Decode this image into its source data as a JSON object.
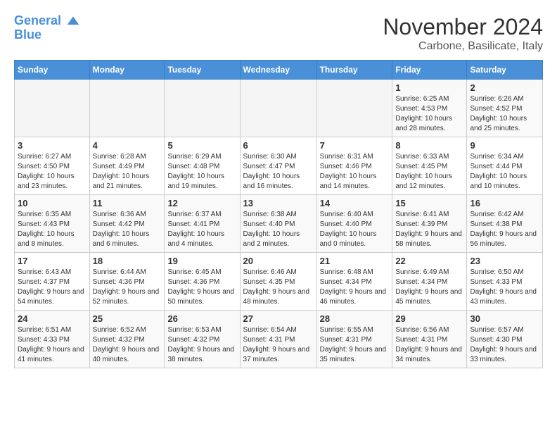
{
  "header": {
    "logo_line1": "General",
    "logo_line2": "Blue",
    "month_title": "November 2024",
    "location": "Carbone, Basilicate, Italy"
  },
  "columns": [
    "Sunday",
    "Monday",
    "Tuesday",
    "Wednesday",
    "Thursday",
    "Friday",
    "Saturday"
  ],
  "weeks": [
    [
      {
        "day": "",
        "info": ""
      },
      {
        "day": "",
        "info": ""
      },
      {
        "day": "",
        "info": ""
      },
      {
        "day": "",
        "info": ""
      },
      {
        "day": "",
        "info": ""
      },
      {
        "day": "1",
        "info": "Sunrise: 6:25 AM\nSunset: 4:53 PM\nDaylight: 10 hours and 28 minutes."
      },
      {
        "day": "2",
        "info": "Sunrise: 6:26 AM\nSunset: 4:52 PM\nDaylight: 10 hours and 25 minutes."
      }
    ],
    [
      {
        "day": "3",
        "info": "Sunrise: 6:27 AM\nSunset: 4:50 PM\nDaylight: 10 hours and 23 minutes."
      },
      {
        "day": "4",
        "info": "Sunrise: 6:28 AM\nSunset: 4:49 PM\nDaylight: 10 hours and 21 minutes."
      },
      {
        "day": "5",
        "info": "Sunrise: 6:29 AM\nSunset: 4:48 PM\nDaylight: 10 hours and 19 minutes."
      },
      {
        "day": "6",
        "info": "Sunrise: 6:30 AM\nSunset: 4:47 PM\nDaylight: 10 hours and 16 minutes."
      },
      {
        "day": "7",
        "info": "Sunrise: 6:31 AM\nSunset: 4:46 PM\nDaylight: 10 hours and 14 minutes."
      },
      {
        "day": "8",
        "info": "Sunrise: 6:33 AM\nSunset: 4:45 PM\nDaylight: 10 hours and 12 minutes."
      },
      {
        "day": "9",
        "info": "Sunrise: 6:34 AM\nSunset: 4:44 PM\nDaylight: 10 hours and 10 minutes."
      }
    ],
    [
      {
        "day": "10",
        "info": "Sunrise: 6:35 AM\nSunset: 4:43 PM\nDaylight: 10 hours and 8 minutes."
      },
      {
        "day": "11",
        "info": "Sunrise: 6:36 AM\nSunset: 4:42 PM\nDaylight: 10 hours and 6 minutes."
      },
      {
        "day": "12",
        "info": "Sunrise: 6:37 AM\nSunset: 4:41 PM\nDaylight: 10 hours and 4 minutes."
      },
      {
        "day": "13",
        "info": "Sunrise: 6:38 AM\nSunset: 4:40 PM\nDaylight: 10 hours and 2 minutes."
      },
      {
        "day": "14",
        "info": "Sunrise: 6:40 AM\nSunset: 4:40 PM\nDaylight: 10 hours and 0 minutes."
      },
      {
        "day": "15",
        "info": "Sunrise: 6:41 AM\nSunset: 4:39 PM\nDaylight: 9 hours and 58 minutes."
      },
      {
        "day": "16",
        "info": "Sunrise: 6:42 AM\nSunset: 4:38 PM\nDaylight: 9 hours and 56 minutes."
      }
    ],
    [
      {
        "day": "17",
        "info": "Sunrise: 6:43 AM\nSunset: 4:37 PM\nDaylight: 9 hours and 54 minutes."
      },
      {
        "day": "18",
        "info": "Sunrise: 6:44 AM\nSunset: 4:36 PM\nDaylight: 9 hours and 52 minutes."
      },
      {
        "day": "19",
        "info": "Sunrise: 6:45 AM\nSunset: 4:36 PM\nDaylight: 9 hours and 50 minutes."
      },
      {
        "day": "20",
        "info": "Sunrise: 6:46 AM\nSunset: 4:35 PM\nDaylight: 9 hours and 48 minutes."
      },
      {
        "day": "21",
        "info": "Sunrise: 6:48 AM\nSunset: 4:34 PM\nDaylight: 9 hours and 46 minutes."
      },
      {
        "day": "22",
        "info": "Sunrise: 6:49 AM\nSunset: 4:34 PM\nDaylight: 9 hours and 45 minutes."
      },
      {
        "day": "23",
        "info": "Sunrise: 6:50 AM\nSunset: 4:33 PM\nDaylight: 9 hours and 43 minutes."
      }
    ],
    [
      {
        "day": "24",
        "info": "Sunrise: 6:51 AM\nSunset: 4:33 PM\nDaylight: 9 hours and 41 minutes."
      },
      {
        "day": "25",
        "info": "Sunrise: 6:52 AM\nSunset: 4:32 PM\nDaylight: 9 hours and 40 minutes."
      },
      {
        "day": "26",
        "info": "Sunrise: 6:53 AM\nSunset: 4:32 PM\nDaylight: 9 hours and 38 minutes."
      },
      {
        "day": "27",
        "info": "Sunrise: 6:54 AM\nSunset: 4:31 PM\nDaylight: 9 hours and 37 minutes."
      },
      {
        "day": "28",
        "info": "Sunrise: 6:55 AM\nSunset: 4:31 PM\nDaylight: 9 hours and 35 minutes."
      },
      {
        "day": "29",
        "info": "Sunrise: 6:56 AM\nSunset: 4:31 PM\nDaylight: 9 hours and 34 minutes."
      },
      {
        "day": "30",
        "info": "Sunrise: 6:57 AM\nSunset: 4:30 PM\nDaylight: 9 hours and 33 minutes."
      }
    ]
  ]
}
